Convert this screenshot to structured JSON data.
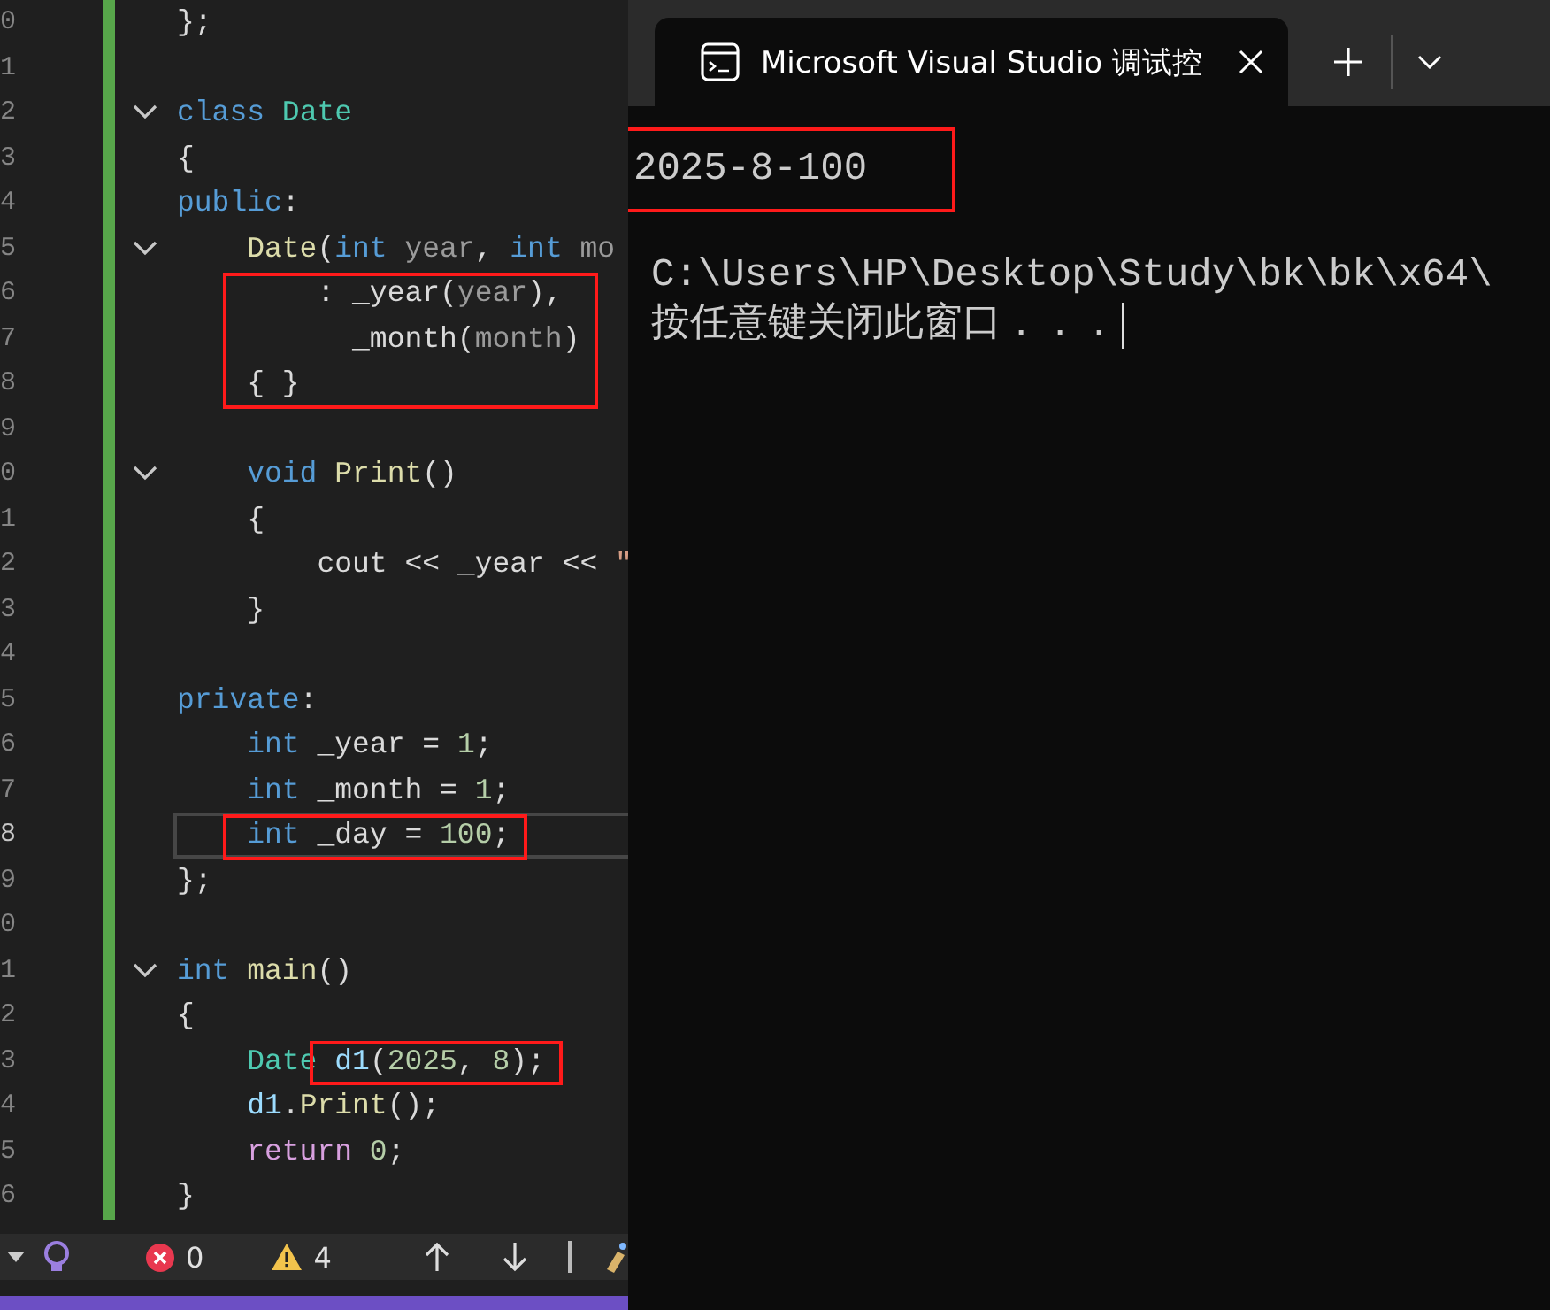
{
  "editor": {
    "lines": [
      {
        "number": "0",
        "tokens": [
          {
            "kind": "plain",
            "text": "};"
          }
        ]
      },
      {
        "number": "1"
      },
      {
        "number": "2",
        "fold": true,
        "tokens": [
          {
            "kind": "keyword",
            "text": "class "
          },
          {
            "kind": "type",
            "text": "Date"
          }
        ]
      },
      {
        "number": "3",
        "tokens": [
          {
            "kind": "plain",
            "text": "{"
          }
        ]
      },
      {
        "number": "4",
        "tokens": [
          {
            "kind": "keyword",
            "text": "public"
          },
          {
            "kind": "plain",
            "text": ":"
          }
        ]
      },
      {
        "number": "5",
        "fold": true,
        "tokens": [
          {
            "kind": "func",
            "text": "    Date"
          },
          {
            "kind": "plain",
            "text": "("
          },
          {
            "kind": "keyword",
            "text": "int "
          },
          {
            "kind": "param",
            "text": "year"
          },
          {
            "kind": "plain",
            "text": ", "
          },
          {
            "kind": "keyword",
            "text": "int "
          },
          {
            "kind": "param",
            "text": "mo"
          }
        ]
      },
      {
        "number": "6",
        "tokens": [
          {
            "kind": "plain",
            "text": "        : _year(",
            "box_start": true
          },
          {
            "kind": "param",
            "text": "year"
          },
          {
            "kind": "plain",
            "text": "),"
          }
        ]
      },
      {
        "number": "7",
        "tokens": [
          {
            "kind": "plain",
            "text": "          _month(",
            "box_start": true
          },
          {
            "kind": "param",
            "text": "month"
          },
          {
            "kind": "plain",
            "text": ")"
          }
        ]
      },
      {
        "number": "8",
        "tokens": [
          {
            "kind": "plain",
            "text": "    { }",
            "box_start": true
          }
        ]
      },
      {
        "number": "9"
      },
      {
        "number": "0",
        "fold": true,
        "tokens": [
          {
            "kind": "keyword",
            "text": "    void "
          },
          {
            "kind": "func",
            "text": "Print"
          },
          {
            "kind": "plain",
            "text": "()"
          }
        ]
      },
      {
        "number": "1",
        "tokens": [
          {
            "kind": "plain",
            "text": "    {"
          }
        ]
      },
      {
        "number": "2",
        "tokens": [
          {
            "kind": "plain",
            "text": "        cout << _year << "
          },
          {
            "kind": "string",
            "text": "\""
          }
        ]
      },
      {
        "number": "3",
        "tokens": [
          {
            "kind": "plain",
            "text": "    }"
          }
        ]
      },
      {
        "number": "4"
      },
      {
        "number": "5",
        "tokens": [
          {
            "kind": "keyword",
            "text": "private"
          },
          {
            "kind": "plain",
            "text": ":"
          }
        ]
      },
      {
        "number": "6",
        "tokens": [
          {
            "kind": "keyword",
            "text": "    int "
          },
          {
            "kind": "plain",
            "text": "_year = "
          },
          {
            "kind": "number",
            "text": "1"
          },
          {
            "kind": "plain",
            "text": ";"
          }
        ]
      },
      {
        "number": "7",
        "tokens": [
          {
            "kind": "keyword",
            "text": "    int "
          },
          {
            "kind": "plain",
            "text": "_month = "
          },
          {
            "kind": "number",
            "text": "1"
          },
          {
            "kind": "plain",
            "text": ";"
          }
        ]
      },
      {
        "number": "8",
        "current": true,
        "tokens": [
          {
            "kind": "keyword",
            "text": "    int ",
            "box_start": true
          },
          {
            "kind": "plain",
            "text": "_day = "
          },
          {
            "kind": "number",
            "text": "100"
          },
          {
            "kind": "plain",
            "text": ";"
          }
        ]
      },
      {
        "number": "9",
        "tokens": [
          {
            "kind": "plain",
            "text": "};"
          }
        ]
      },
      {
        "number": "0"
      },
      {
        "number": "1",
        "fold": true,
        "tokens": [
          {
            "kind": "keyword",
            "text": "int "
          },
          {
            "kind": "func",
            "text": "main"
          },
          {
            "kind": "plain",
            "text": "()"
          }
        ]
      },
      {
        "number": "2",
        "tokens": [
          {
            "kind": "plain",
            "text": "{"
          }
        ]
      },
      {
        "number": "3",
        "tokens": [
          {
            "kind": "type",
            "text": "    Date "
          },
          {
            "kind": "var",
            "text": "d1",
            "box_start": true
          },
          {
            "kind": "plain",
            "text": "("
          },
          {
            "kind": "number",
            "text": "2025"
          },
          {
            "kind": "plain",
            "text": ", "
          },
          {
            "kind": "number",
            "text": "8"
          },
          {
            "kind": "plain",
            "text": ");"
          }
        ]
      },
      {
        "number": "4",
        "tokens": [
          {
            "kind": "var",
            "text": "    d1"
          },
          {
            "kind": "plain",
            "text": "."
          },
          {
            "kind": "func",
            "text": "Print"
          },
          {
            "kind": "plain",
            "text": "();"
          }
        ]
      },
      {
        "number": "5",
        "tokens": [
          {
            "kind": "control",
            "text": "    return "
          },
          {
            "kind": "number",
            "text": "0"
          },
          {
            "kind": "plain",
            "text": ";"
          }
        ]
      },
      {
        "number": "6",
        "tokens": [
          {
            "kind": "plain",
            "text": "}"
          }
        ]
      }
    ]
  },
  "status_bar": {
    "errors": "0",
    "warnings": "4"
  },
  "terminal": {
    "tab": {
      "title": "Microsoft Visual Studio 调试控"
    },
    "output": [
      {
        "text": "2025-8-100",
        "highlighted": true
      },
      {
        "text": "C:\\Users\\HP\\Desktop\\Study\\bk\\bk\\x64\\",
        "highlighted": false
      },
      {
        "text": "按任意键关闭此窗口．．．",
        "highlighted": false,
        "cursor": true
      }
    ]
  }
}
